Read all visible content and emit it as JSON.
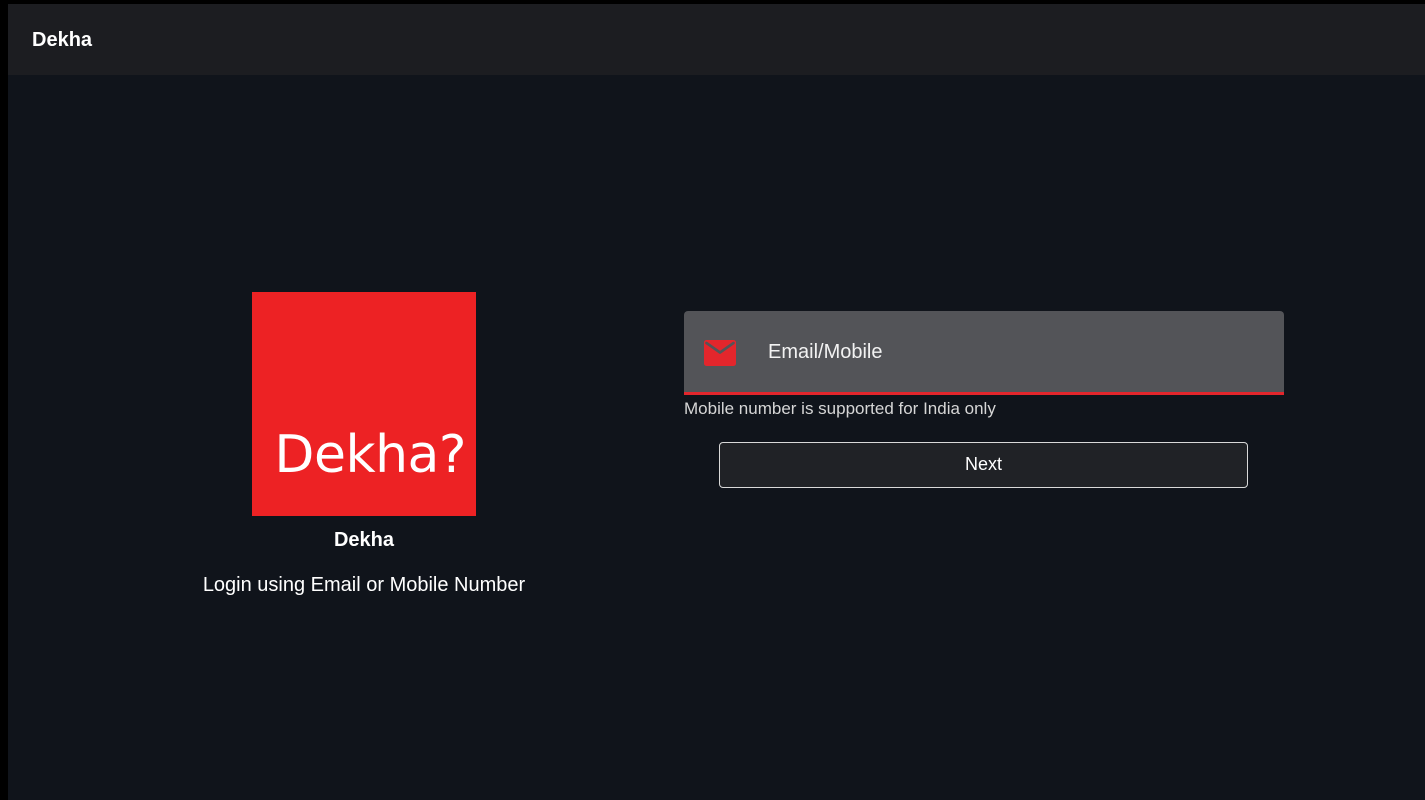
{
  "header": {
    "title": "Dekha"
  },
  "branding": {
    "logo_text": "Dekha?",
    "logo_color": "#ed2224",
    "app_name": "Dekha",
    "login_hint": "Login using Email or Mobile Number"
  },
  "login_form": {
    "field": {
      "icon": "mail-icon",
      "placeholder": "Email/Mobile",
      "value": "",
      "accent_color": "#e3262c"
    },
    "helper_text": "Mobile number is supported for India only",
    "next_label": "Next"
  }
}
